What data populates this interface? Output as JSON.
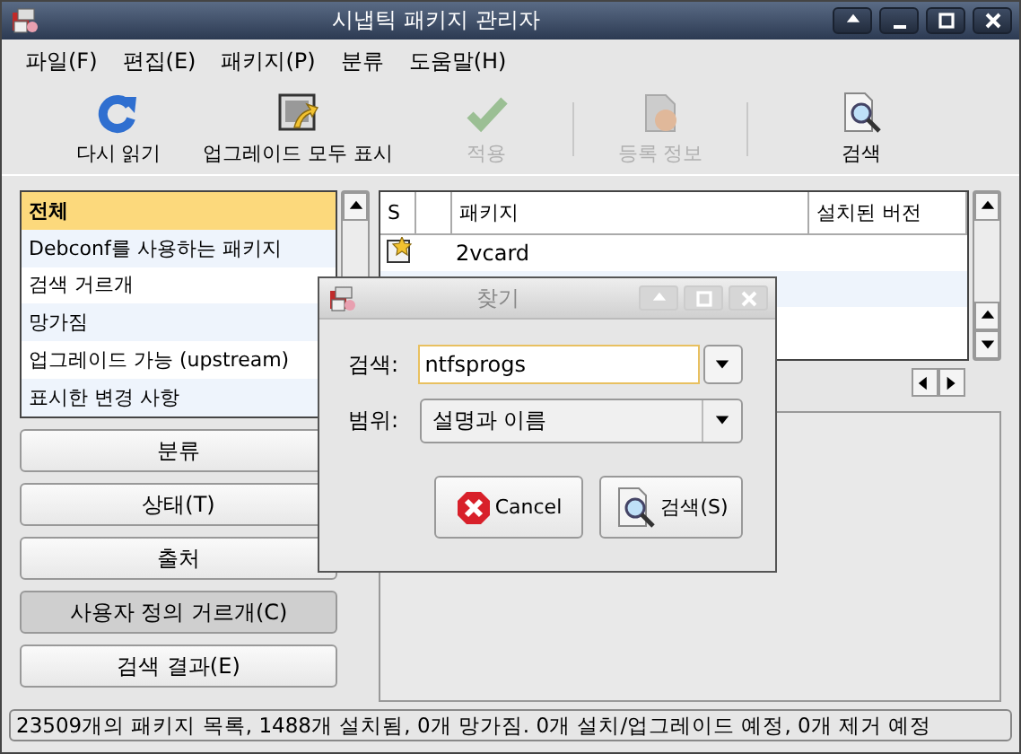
{
  "window": {
    "title": "시냅틱 패키지 관리자"
  },
  "menu": [
    "파일(F)",
    "편집(E)",
    "패키지(P)",
    "분류",
    "도움말(H)"
  ],
  "toolbar": [
    {
      "kind": "reload",
      "label": "다시 읽기",
      "disabled": false
    },
    {
      "kind": "upgrade",
      "label": "업그레이드 모두 표시",
      "disabled": false
    },
    {
      "kind": "apply",
      "label": "적용",
      "disabled": true
    },
    {
      "kind": "separator"
    },
    {
      "kind": "properties",
      "label": "등록 정보",
      "disabled": true
    },
    {
      "kind": "separator"
    },
    {
      "kind": "search",
      "label": "검색",
      "disabled": false
    }
  ],
  "filters": [
    {
      "label": "전체",
      "selected": true
    },
    {
      "label": "Debconf를 사용하는 패키지",
      "selected": false
    },
    {
      "label": "검색 거르개",
      "selected": false
    },
    {
      "label": "망가짐",
      "selected": false
    },
    {
      "label": "업그레이드 가능 (upstream)",
      "selected": false
    },
    {
      "label": "표시한 변경 사항",
      "selected": false
    }
  ],
  "views": [
    {
      "label": "분류",
      "selected": false
    },
    {
      "label": "상태(T)",
      "selected": false
    },
    {
      "label": "출처",
      "selected": false
    },
    {
      "label": "사용자 정의 거르개(C)",
      "selected": true
    },
    {
      "label": "검색 결과(E)",
      "selected": false
    }
  ],
  "table": {
    "columns": [
      "S",
      "패키지",
      "설치된 버전"
    ],
    "rows": [
      {
        "new": true,
        "package": "2vcard"
      }
    ]
  },
  "dialog": {
    "title": "찾기",
    "search_label": "검색:",
    "search_value": "ntfsprogs",
    "scope_label": "범위:",
    "scope_value": "설명과 이름",
    "cancel": "Cancel",
    "search_button": "검색(S)"
  },
  "status_bar": "23509개의 패키지 목록, 1488개 설치됨, 0개 망가짐. 0개 설치/업그레이드 예정, 0개 제거 예정"
}
